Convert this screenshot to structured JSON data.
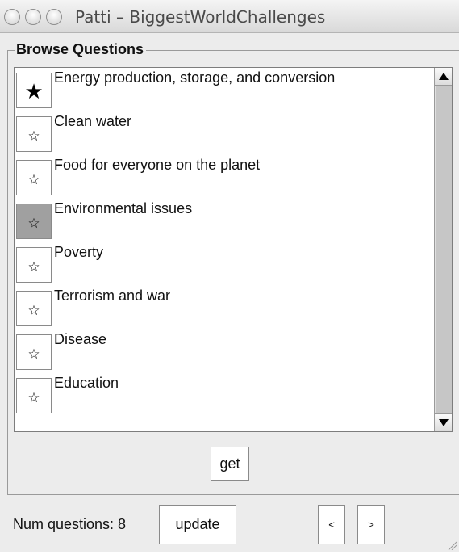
{
  "window": {
    "title": "Patti – BiggestWorldChallenges"
  },
  "browse": {
    "group_title": "Browse Questions",
    "items": [
      {
        "label": "Energy production, storage, and conversion",
        "star": "★",
        "icon": "star-filled",
        "pressed": false
      },
      {
        "label": "Clean water",
        "star": "☆",
        "icon": "star-outline",
        "pressed": false
      },
      {
        "label": "Food for everyone on the planet",
        "star": "☆",
        "icon": "star-outline",
        "pressed": false
      },
      {
        "label": "Environmental issues",
        "star": "☆",
        "icon": "star-outline",
        "pressed": true
      },
      {
        "label": "Poverty",
        "star": "☆",
        "icon": "star-outline",
        "pressed": false
      },
      {
        "label": "Terrorism and war",
        "star": "☆",
        "icon": "star-outline",
        "pressed": false
      },
      {
        "label": "Disease",
        "star": "☆",
        "icon": "star-outline",
        "pressed": false
      },
      {
        "label": "Education",
        "star": "☆",
        "icon": "star-outline",
        "pressed": false
      }
    ],
    "get_label": "get"
  },
  "footer": {
    "num_questions_label": "Num questions: 8",
    "update_label": "update",
    "prev_label": "<",
    "next_label": ">"
  },
  "colors": {
    "window_bg": "#ececec",
    "list_bg": "#ffffff",
    "pressed_bg": "#a0a0a0",
    "scroll_track": "#c6c6c6"
  }
}
